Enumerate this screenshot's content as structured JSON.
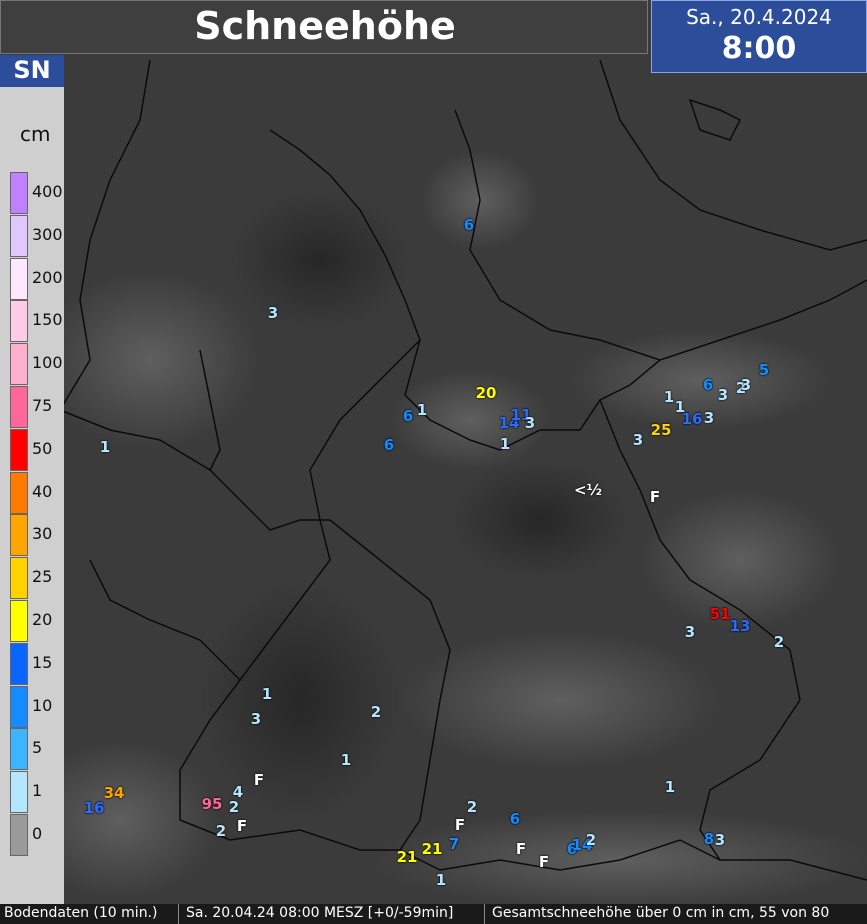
{
  "header": {
    "title": "Schneehöhe",
    "date": "Sa., 20.4.2024",
    "time": "8:00"
  },
  "legend": {
    "code": "SN",
    "unit": "cm",
    "steps": [
      {
        "label": "400",
        "color": "#c080ff"
      },
      {
        "label": "300",
        "color": "#e0c8ff"
      },
      {
        "label": "200",
        "color": "#ffe8ff"
      },
      {
        "label": "150",
        "color": "#ffcce8"
      },
      {
        "label": "100",
        "color": "#ffb0cc"
      },
      {
        "label": "75",
        "color": "#ff6699"
      },
      {
        "label": "50",
        "color": "#ff0000"
      },
      {
        "label": "40",
        "color": "#ff7a00"
      },
      {
        "label": "30",
        "color": "#ffa500"
      },
      {
        "label": "25",
        "color": "#ffd200"
      },
      {
        "label": "20",
        "color": "#ffff00"
      },
      {
        "label": "15",
        "color": "#0a64ff"
      },
      {
        "label": "10",
        "color": "#148cff"
      },
      {
        "label": "5",
        "color": "#3cb4ff"
      },
      {
        "label": "1",
        "color": "#b4e6ff"
      },
      {
        "label": "0",
        "color": "#9a9a9a"
      }
    ]
  },
  "colors": {
    "c1": "#b4e6ff",
    "c5": "#3cb4ff",
    "c10": "#148cff",
    "c15": "#2a6cff",
    "c20": "#ffff00",
    "c25": "#ffd200",
    "c30": "#ffa500",
    "c50": "#ff0000",
    "c75": "#ff6699",
    "white": "#ffffff"
  },
  "stations": [
    {
      "v": "6",
      "c": "c10"
    },
    {
      "v": "3",
      "c": "c1"
    },
    {
      "v": "1",
      "c": "c1"
    },
    {
      "v": "20",
      "c": "c20"
    },
    {
      "v": "6",
      "c": "c10"
    },
    {
      "v": "1",
      "c": "c1"
    },
    {
      "v": "6",
      "c": "c10"
    },
    {
      "v": "14",
      "c": "c15"
    },
    {
      "v": "11",
      "c": "c15"
    },
    {
      "v": "3",
      "c": "c1"
    },
    {
      "v": "1",
      "c": "c1"
    },
    {
      "v": "<½",
      "c": "white"
    },
    {
      "v": "1",
      "c": "c1"
    },
    {
      "v": "1",
      "c": "c1"
    },
    {
      "v": "6",
      "c": "c10"
    },
    {
      "v": "3",
      "c": "c1"
    },
    {
      "v": "2",
      "c": "c1"
    },
    {
      "v": "3",
      "c": "c1"
    },
    {
      "v": "5",
      "c": "c10"
    },
    {
      "v": "16",
      "c": "c15"
    },
    {
      "v": "3",
      "c": "c1"
    },
    {
      "v": "25",
      "c": "c25"
    },
    {
      "v": "3",
      "c": "c1"
    },
    {
      "v": "F",
      "c": "white"
    },
    {
      "v": "51",
      "c": "c50"
    },
    {
      "v": "13",
      "c": "c15"
    },
    {
      "v": "3",
      "c": "c1"
    },
    {
      "v": "2",
      "c": "c1"
    },
    {
      "v": "1",
      "c": "c1"
    },
    {
      "v": "3",
      "c": "c1"
    },
    {
      "v": "2",
      "c": "c1"
    },
    {
      "v": "1",
      "c": "c1"
    },
    {
      "v": "34",
      "c": "c30"
    },
    {
      "v": "16",
      "c": "c15"
    },
    {
      "v": "4",
      "c": "c1"
    },
    {
      "v": "F",
      "c": "white"
    },
    {
      "v": "95",
      "c": "c75"
    },
    {
      "v": "2",
      "c": "c1"
    },
    {
      "v": "2",
      "c": "c1"
    },
    {
      "v": "F",
      "c": "white"
    },
    {
      "v": "2",
      "c": "c1"
    },
    {
      "v": "F",
      "c": "white"
    },
    {
      "v": "6",
      "c": "c10"
    },
    {
      "v": "F",
      "c": "white"
    },
    {
      "v": "F",
      "c": "white"
    },
    {
      "v": "6",
      "c": "c10"
    },
    {
      "v": "14",
      "c": "c10"
    },
    {
      "v": "2",
      "c": "c1"
    },
    {
      "v": "21",
      "c": "c20"
    },
    {
      "v": "21",
      "c": "c20"
    },
    {
      "v": "7",
      "c": "c10"
    },
    {
      "v": "1",
      "c": "c1"
    },
    {
      "v": "1",
      "c": "c1"
    },
    {
      "v": "8",
      "c": "c10"
    },
    {
      "v": "3",
      "c": "c1"
    }
  ],
  "footer": {
    "source": "Bodendaten (10 min.)",
    "timestamp": "Sa. 20.04.24 08:00 MESZ [+0/-59min]",
    "description": "Gesamtschneehöhe über 0 cm  in cm, 55 von 80"
  }
}
